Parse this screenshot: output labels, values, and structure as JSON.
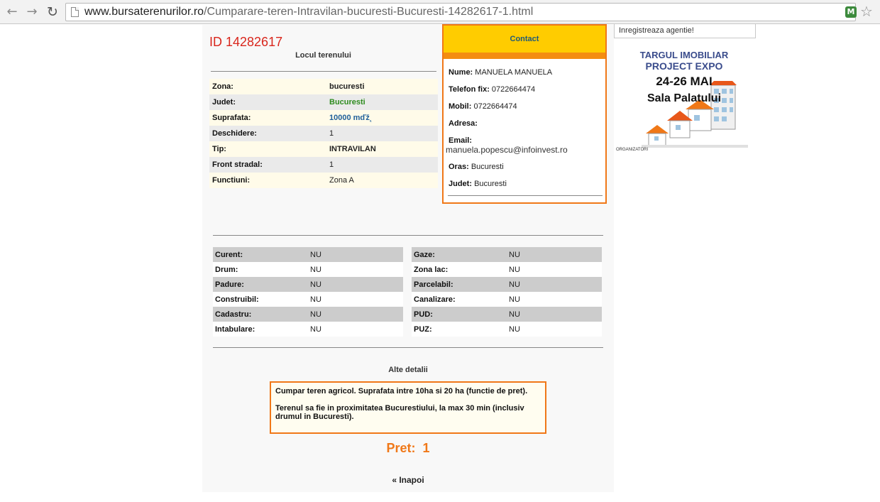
{
  "browser": {
    "url_host": "www.bursaterenurilor.ro",
    "url_path": "/Cumparare-teren-Intravilan-bucuresti-Bucuresti-14282617-1.html"
  },
  "listing": {
    "id_title": "ID 14282617",
    "location_title": "Locul terenului",
    "details": [
      {
        "label": "Zona:",
        "value": "bucuresti"
      },
      {
        "label": "Judet:",
        "value": "Bucuresti"
      },
      {
        "label": "Suprafata:",
        "value": "10000 mďž˛"
      },
      {
        "label": "Deschidere:",
        "value": "1"
      },
      {
        "label": "Tip:",
        "value": "INTRAVILAN"
      },
      {
        "label": "Front stradal:",
        "value": "1"
      },
      {
        "label": "Functiuni:",
        "value": "Zona A"
      }
    ]
  },
  "contact": {
    "title": "Contact",
    "nume_label": "Nume:",
    "nume_value": "MANUELA MANUELA",
    "telefon_label": "Telefon fix:",
    "telefon_value": "0722664474",
    "mobil_label": "Mobil:",
    "mobil_value": "0722664474",
    "adresa_label": "Adresa:",
    "adresa_value": "",
    "email_label": "Email:",
    "email_value": "manuela.popescu@infoinvest.ro",
    "oras_label": "Oras:",
    "oras_value": "Bucuresti",
    "judet_label": "Judet:",
    "judet_value": "Bucuresti"
  },
  "utilities_left": [
    {
      "label": "Curent:",
      "value": "NU"
    },
    {
      "label": "Drum:",
      "value": "NU"
    },
    {
      "label": "Padure:",
      "value": "NU"
    },
    {
      "label": "Construibil:",
      "value": "NU"
    },
    {
      "label": "Cadastru:",
      "value": "NU"
    },
    {
      "label": "Intabulare:",
      "value": "NU"
    }
  ],
  "utilities_right": [
    {
      "label": "Gaze:",
      "value": "NU"
    },
    {
      "label": "Zona lac:",
      "value": "NU"
    },
    {
      "label": "Parcelabil:",
      "value": "NU"
    },
    {
      "label": "Canalizare:",
      "value": "NU"
    },
    {
      "label": "PUD:",
      "value": "NU"
    },
    {
      "label": "PUZ:",
      "value": "NU"
    }
  ],
  "other": {
    "title": "Alte detalii",
    "paragraph1": "Cumpar teren agricol. Suprafata intre 10ha si 20 ha (functie de pret).",
    "paragraph2": "Terenul sa fie in proximitatea Bucurestiului, la max 30 min (inclusiv drumul in Bucuresti)."
  },
  "price": {
    "label": "Pret:",
    "value": "1"
  },
  "back_link": "« Inapoi",
  "sidebar": {
    "register_agency": "Inregistreaza agentie!",
    "ad_line1": "TARGUL IMOBILIAR",
    "ad_line2": "PROJECT EXPO",
    "ad_line3": "24-26 MAI",
    "ad_line4": "Sala Palatului",
    "ad_footer": "ORGANIZATORI"
  }
}
